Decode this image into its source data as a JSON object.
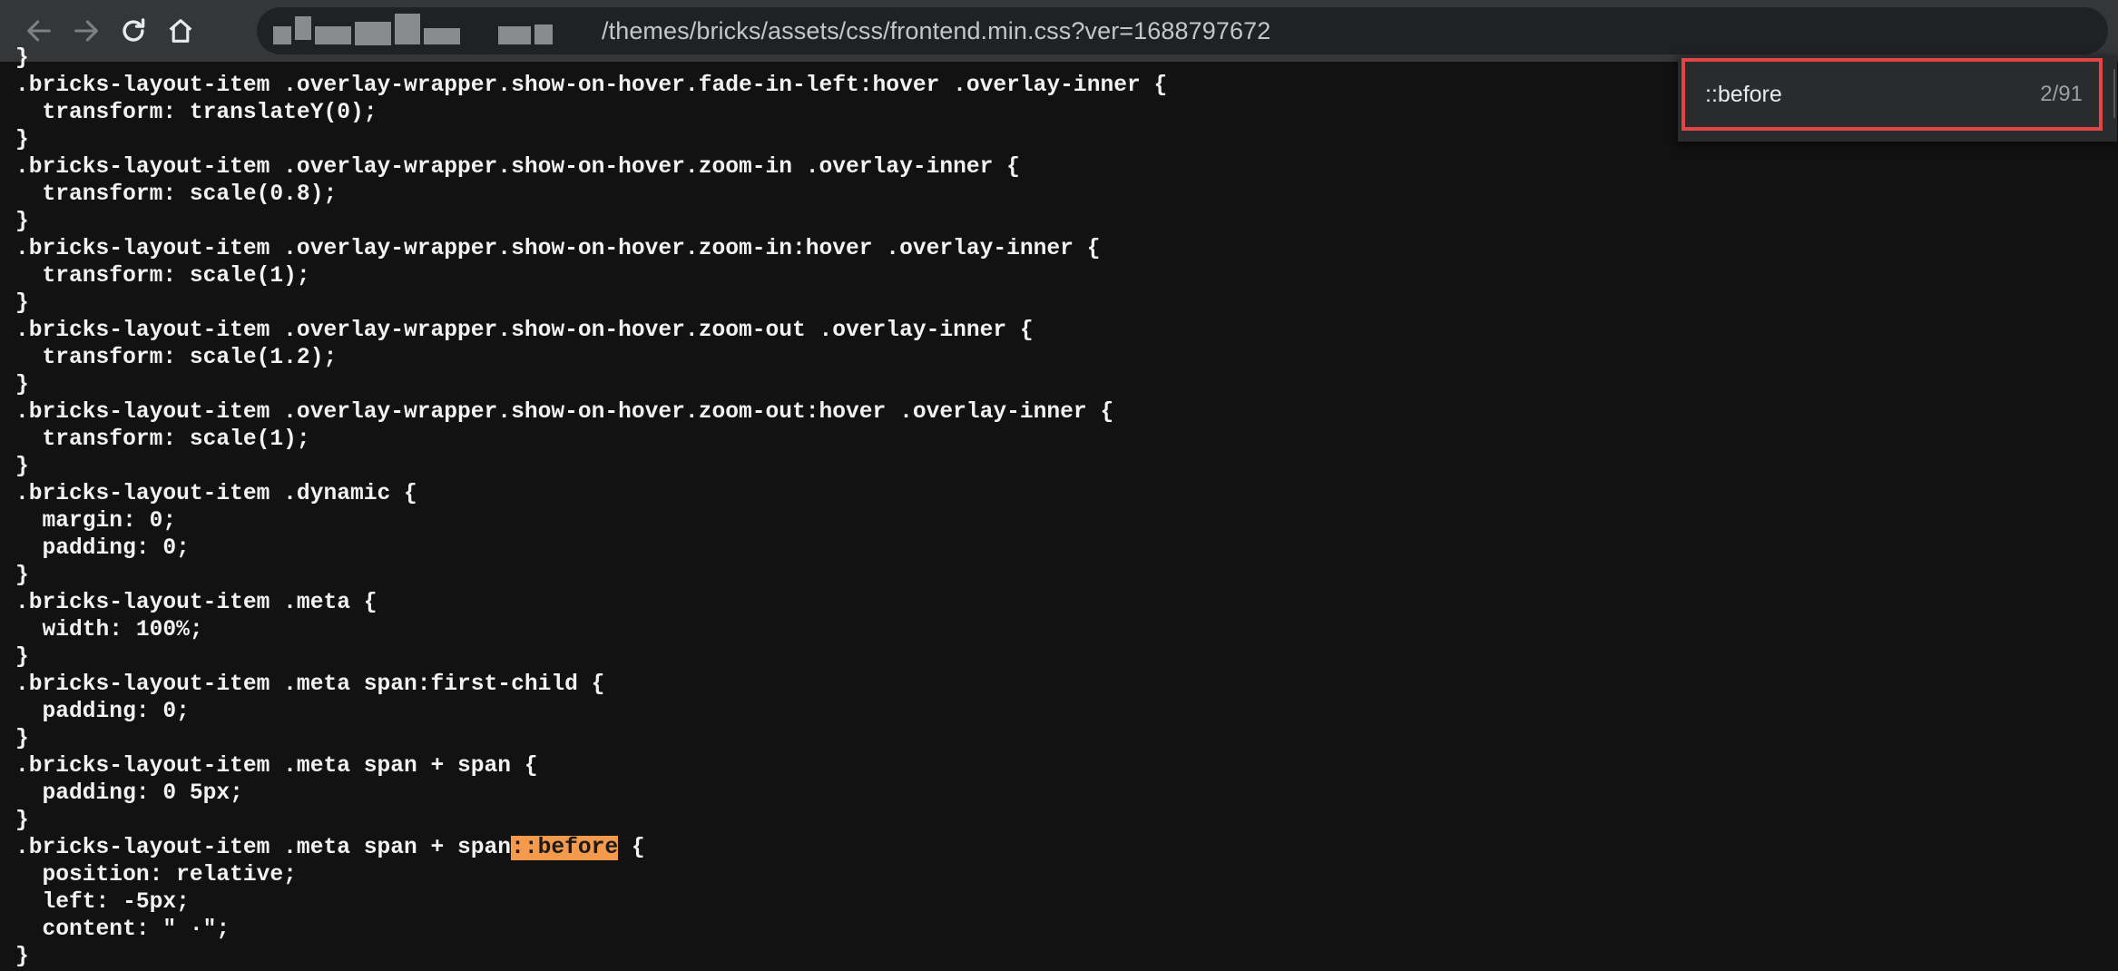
{
  "browser": {
    "url_visible": "/themes/bricks/assets/css/frontend.min.css?ver=1688797672"
  },
  "find": {
    "query": "::before",
    "count": "2/91"
  },
  "code_lines": [
    "}",
    ".bricks-layout-item .overlay-wrapper.show-on-hover.fade-in-left:hover .overlay-inner {",
    "  transform: translateY(0);",
    "}",
    ".bricks-layout-item .overlay-wrapper.show-on-hover.zoom-in .overlay-inner {",
    "  transform: scale(0.8);",
    "}",
    ".bricks-layout-item .overlay-wrapper.show-on-hover.zoom-in:hover .overlay-inner {",
    "  transform: scale(1);",
    "}",
    ".bricks-layout-item .overlay-wrapper.show-on-hover.zoom-out .overlay-inner {",
    "  transform: scale(1.2);",
    "}",
    ".bricks-layout-item .overlay-wrapper.show-on-hover.zoom-out:hover .overlay-inner {",
    "  transform: scale(1);",
    "}",
    ".bricks-layout-item .dynamic {",
    "  margin: 0;",
    "  padding: 0;",
    "}",
    ".bricks-layout-item .meta {",
    "  width: 100%;",
    "}",
    ".bricks-layout-item .meta span:first-child {",
    "  padding: 0;",
    "}",
    ".bricks-layout-item .meta span + span {",
    "  padding: 0 5px;",
    "}",
    "__HL__",
    "  position: relative;",
    "  left: -5px;",
    "  content: \" ·\";",
    "}"
  ],
  "highlight_line": {
    "before": ".bricks-layout-item .meta span + span",
    "match": "::before",
    "after": " {"
  },
  "colors": {
    "background": "#121212",
    "toolbar": "#353638",
    "highlight": "#f39a4d",
    "find_border": "#e34545"
  }
}
